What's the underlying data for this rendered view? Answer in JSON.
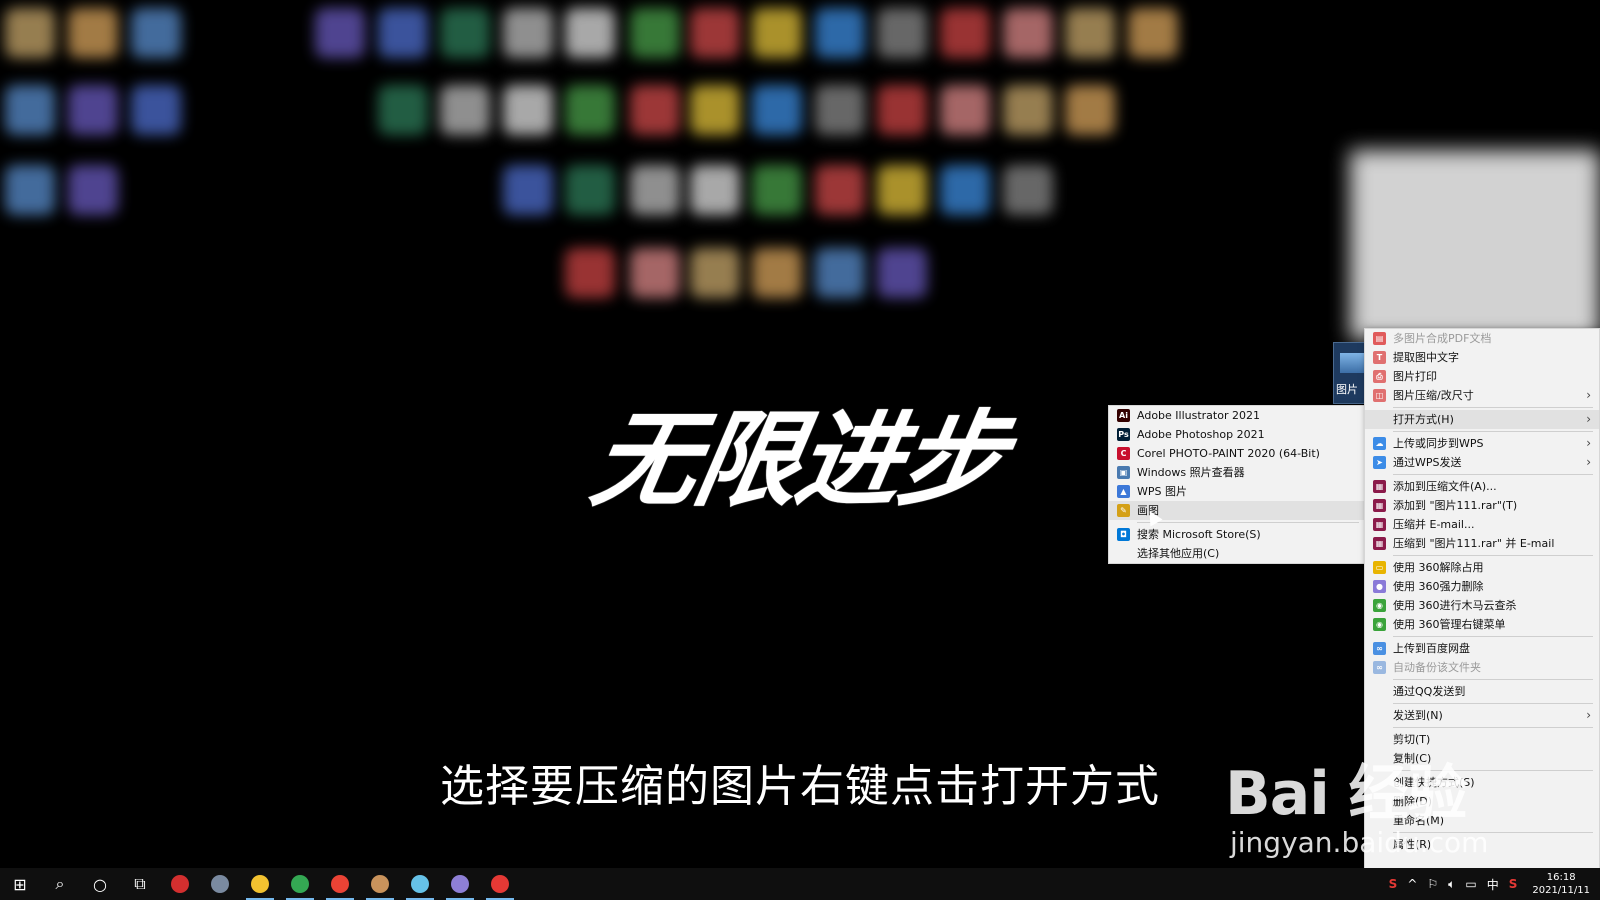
{
  "logo_text": "无限进步",
  "subtitle": "选择要压缩的图片右键点击打开方式",
  "desktop_file": {
    "label": "图片"
  },
  "open_with_menu": {
    "items": [
      {
        "label": "Adobe Illustrator 2021",
        "icon": "illustrator-icon",
        "color": "#330000",
        "glyph": "Ai"
      },
      {
        "label": "Adobe Photoshop 2021",
        "icon": "photoshop-icon",
        "color": "#001e36",
        "glyph": "Ps"
      },
      {
        "label": "Corel PHOTO-PAINT 2020 (64-Bit)",
        "icon": "corel-icon",
        "color": "#c8102e",
        "glyph": "C"
      },
      {
        "label": "Windows 照片查看器",
        "icon": "photo-viewer-icon",
        "color": "#4a7ab0",
        "glyph": "▣"
      },
      {
        "label": "WPS 图片",
        "icon": "wps-picture-icon",
        "color": "#3c78d8",
        "glyph": "▲"
      },
      {
        "label": "画图",
        "icon": "paint-icon",
        "color": "#d4a017",
        "glyph": "✎"
      },
      {
        "label": "搜索 Microsoft Store(S)",
        "icon": "store-icon",
        "color": "#0078d7",
        "glyph": "◘"
      },
      {
        "label": "选择其他应用(C)",
        "icon": "",
        "color": "",
        "glyph": ""
      }
    ]
  },
  "context_menu": {
    "items": [
      {
        "label": "多图片合成PDF文档",
        "icon": "pdf-icon",
        "color": "#e05a5a",
        "glyph": "▤",
        "disabled": true
      },
      {
        "label": "提取图中文字",
        "icon": "ocr-icon",
        "color": "#e07070",
        "glyph": "T"
      },
      {
        "label": "图片打印",
        "icon": "print-icon",
        "color": "#e07070",
        "glyph": "⎙"
      },
      {
        "label": "图片压缩/改尺寸",
        "icon": "compress-icon",
        "color": "#e07070",
        "glyph": "◫",
        "arrow": "›"
      },
      {
        "label": "打开方式(H)",
        "icon": "",
        "color": "",
        "glyph": "",
        "arrow": "›",
        "highlight": true
      },
      {
        "label": "上传或同步到WPS",
        "icon": "wps-cloud-icon",
        "color": "#3c8ce7",
        "glyph": "☁",
        "arrow": "›"
      },
      {
        "label": "通过WPS发送",
        "icon": "wps-send-icon",
        "color": "#3c8ce7",
        "glyph": "➤",
        "arrow": "›"
      },
      {
        "label": "添加到压缩文件(A)...",
        "icon": "winrar-icon",
        "color": "#8b1a4a",
        "glyph": "▦"
      },
      {
        "label": "添加到 \"图片111.rar\"(T)",
        "icon": "winrar-icon",
        "color": "#8b1a4a",
        "glyph": "▦"
      },
      {
        "label": "压缩并 E-mail...",
        "icon": "winrar-icon",
        "color": "#8b1a4a",
        "glyph": "▦"
      },
      {
        "label": "压缩到 \"图片111.rar\" 并 E-mail",
        "icon": "winrar-icon",
        "color": "#8b1a4a",
        "glyph": "▦"
      },
      {
        "label": "使用 360解除占用",
        "icon": "360-unlock-icon",
        "color": "#e8b400",
        "glyph": "▭"
      },
      {
        "label": "使用 360强力删除",
        "icon": "360-delete-icon",
        "color": "#8a7ad8",
        "glyph": "●"
      },
      {
        "label": "使用 360进行木马云查杀",
        "icon": "360-scan-icon",
        "color": "#3aa33a",
        "glyph": "◉"
      },
      {
        "label": "使用 360管理右键菜单",
        "icon": "360-menu-icon",
        "color": "#3aa33a",
        "glyph": "◉"
      },
      {
        "label": "上传到百度网盘",
        "icon": "baidu-pan-icon",
        "color": "#4a90e2",
        "glyph": "∞"
      },
      {
        "label": "自动备份该文件夹",
        "icon": "baidu-backup-icon",
        "color": "#9ab8e0",
        "glyph": "∞",
        "disabled": true
      },
      {
        "label": "通过QQ发送到",
        "icon": "",
        "color": "",
        "glyph": ""
      },
      {
        "label": "发送到(N)",
        "icon": "",
        "color": "",
        "glyph": "",
        "arrow": "›"
      },
      {
        "label": "剪切(T)",
        "icon": "",
        "color": "",
        "glyph": ""
      },
      {
        "label": "复制(C)",
        "icon": "",
        "color": "",
        "glyph": ""
      },
      {
        "label": "创建快捷方式(S)",
        "icon": "",
        "color": "",
        "glyph": ""
      },
      {
        "label": "删除(D)",
        "icon": "",
        "color": "",
        "glyph": ""
      },
      {
        "label": "重命名(M)",
        "icon": "",
        "color": "",
        "glyph": ""
      },
      {
        "label": "属性(R)",
        "icon": "",
        "color": "",
        "glyph": ""
      }
    ],
    "separators_after": [
      3,
      4,
      6,
      10,
      14,
      16,
      17,
      18,
      20,
      23
    ]
  },
  "watermark": {
    "brand": "Bai 经验",
    "url": "jingyan.baidu.com"
  },
  "taskbar": {
    "apps": [
      {
        "name": "start-button",
        "glyph": "⊞"
      },
      {
        "name": "search-button",
        "glyph": "⌕"
      },
      {
        "name": "cortana-button",
        "glyph": "○"
      },
      {
        "name": "task-view-button",
        "glyph": "⧉"
      },
      {
        "name": "recorder-app",
        "color": "#d32f2f"
      },
      {
        "name": "app-2",
        "color": "#7a8aa0"
      },
      {
        "name": "file-explorer-app",
        "color": "#f2c230"
      },
      {
        "name": "chrome-app",
        "color": "#34a853"
      },
      {
        "name": "chrome-app-2",
        "color": "#ea4335"
      },
      {
        "name": "app-6",
        "color": "#c9935c"
      },
      {
        "name": "app-7",
        "color": "#66c2e8"
      },
      {
        "name": "app-8",
        "color": "#8e7fd6"
      },
      {
        "name": "record-app",
        "color": "#e53935"
      }
    ],
    "tray": {
      "wps": "S",
      "chevron": "^",
      "ime": "中",
      "sogou": "S"
    },
    "time": "16:18",
    "date": "2021/11/11"
  }
}
